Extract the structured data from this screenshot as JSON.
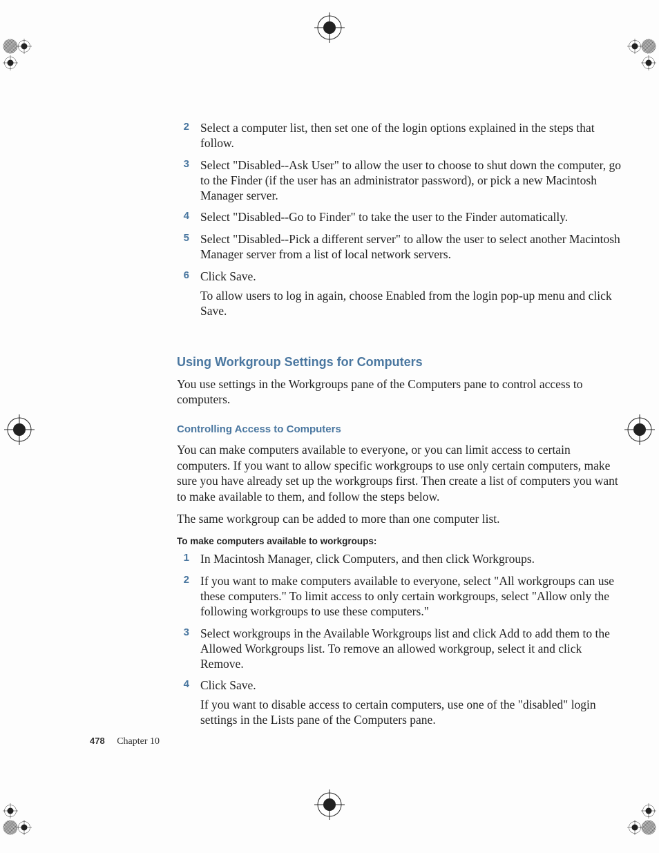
{
  "list1": {
    "items": [
      {
        "n": "2",
        "t": "Select a computer list, then set one of the login options explained in the steps that follow."
      },
      {
        "n": "3",
        "t": "Select \"Disabled--Ask User\" to allow the user to choose to shut down the computer, go to the Finder (if the user has an administrator password), or pick a new Macintosh Manager server."
      },
      {
        "n": "4",
        "t": "Select \"Disabled--Go to Finder\" to take the user to the Finder automatically."
      },
      {
        "n": "5",
        "t": "Select \"Disabled--Pick a different server\" to allow the user to select another Macintosh Manager server from a list of local network servers."
      },
      {
        "n": "6",
        "t": "Click Save.",
        "extra": "To allow users to log in again, choose Enabled from the login pop-up menu and click Save."
      }
    ]
  },
  "section": {
    "heading": "Using Workgroup Settings for Computers",
    "intro": "You use settings in the Workgroups pane of the Computers pane to control access to computers.",
    "subheading": "Controlling Access to Computers",
    "p1": "You can make computers available to everyone, or you can limit access to certain computers. If you want to allow specific workgroups to use only certain computers, make sure you have already set up the workgroups first. Then create a list of computers you want to make available to them, and follow the steps below.",
    "p2": "The same workgroup can be added to more than one computer list.",
    "task_heading": "To make computers available to workgroups:"
  },
  "list2": {
    "items": [
      {
        "n": "1",
        "t": "In Macintosh Manager, click Computers, and then click Workgroups."
      },
      {
        "n": "2",
        "t": "If you want to make computers available to everyone, select \"All workgroups can use these computers.\" To limit access to only certain workgroups, select \"Allow only the following workgroups to use these computers.\""
      },
      {
        "n": "3",
        "t": "Select workgroups in the Available Workgroups list and click Add to add them to the Allowed Workgroups list. To remove an allowed workgroup, select it and click Remove."
      },
      {
        "n": "4",
        "t": "Click Save.",
        "extra": "If you want to disable access to certain computers, use one of the \"disabled\" login settings in the Lists pane of the Computers pane."
      }
    ]
  },
  "footer": {
    "page": "478",
    "chapter": "Chapter 10"
  }
}
